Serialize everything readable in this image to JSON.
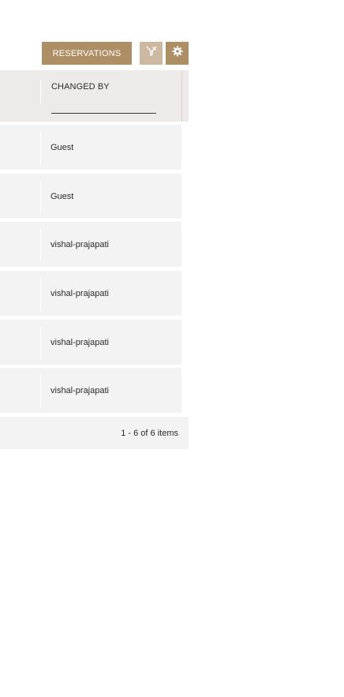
{
  "toolbar": {
    "reservations_label": "RESERVATIONS",
    "filter_icon": "filter-off-icon",
    "settings_icon": "gear-icon"
  },
  "grid": {
    "column_header": "CHANGED BY",
    "rows": [
      {
        "changed_by": "Guest"
      },
      {
        "changed_by": "Guest"
      },
      {
        "changed_by": "vishal-prajapati"
      },
      {
        "changed_by": "vishal-prajapati"
      },
      {
        "changed_by": "vishal-prajapati"
      },
      {
        "changed_by": "vishal-prajapati"
      }
    ]
  },
  "pager": {
    "info": "1 - 6 of 6 items"
  },
  "colors": {
    "accent": "#ae8e64",
    "accent_light": "#cdb9a2",
    "header_bg": "#ecebe9",
    "row_bg": "#f3f3f3"
  }
}
